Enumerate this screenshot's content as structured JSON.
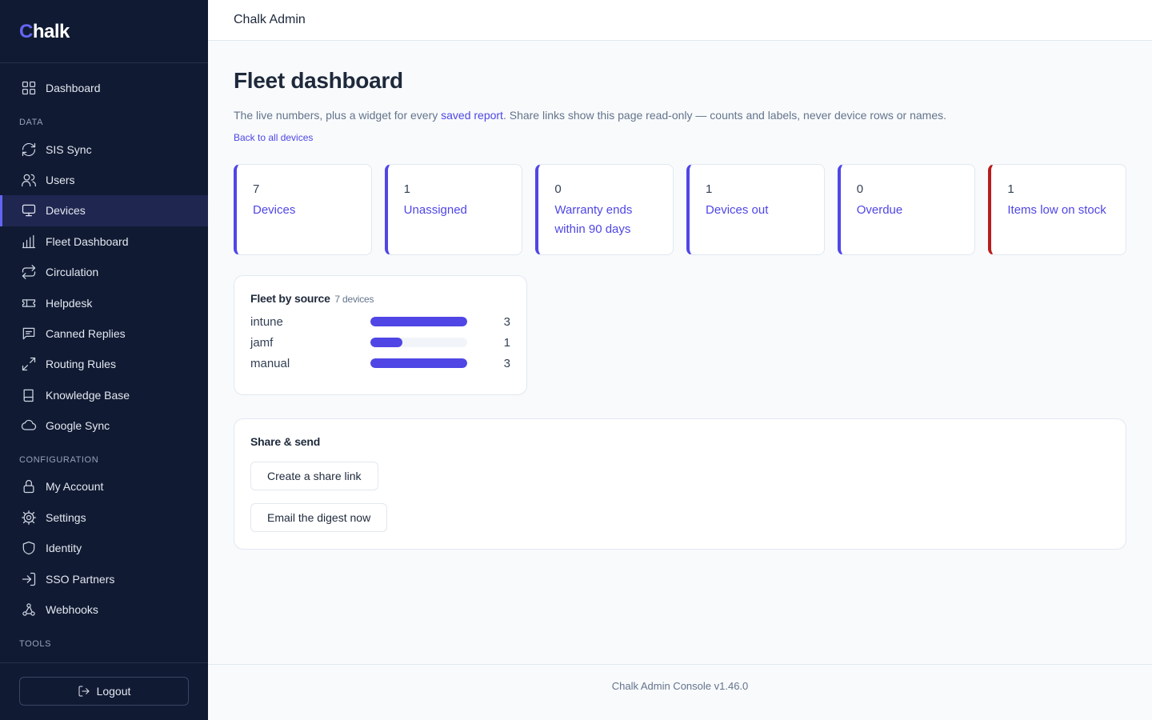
{
  "brand": {
    "first_letter": "C",
    "rest": "halk"
  },
  "sidebar": {
    "items": [
      {
        "label": "Dashboard",
        "icon": "grid-icon"
      },
      {
        "section": "DATA"
      },
      {
        "label": "SIS Sync",
        "icon": "refresh-icon"
      },
      {
        "label": "Users",
        "icon": "users-icon"
      },
      {
        "label": "Devices",
        "icon": "monitor-icon",
        "active": true
      },
      {
        "label": "Fleet Dashboard",
        "icon": "bar-chart-icon"
      },
      {
        "label": "Circulation",
        "icon": "repeat-icon"
      },
      {
        "label": "Helpdesk",
        "icon": "ticket-icon"
      },
      {
        "label": "Canned Replies",
        "icon": "message-icon"
      },
      {
        "label": "Routing Rules",
        "icon": "arrows-icon"
      },
      {
        "label": "Knowledge Base",
        "icon": "book-icon"
      },
      {
        "label": "Google Sync",
        "icon": "cloud-icon"
      },
      {
        "section": "CONFIGURATION"
      },
      {
        "label": "My Account",
        "icon": "lock-icon"
      },
      {
        "label": "Settings",
        "icon": "gear-icon"
      },
      {
        "label": "Identity",
        "icon": "shield-icon"
      },
      {
        "label": "SSO Partners",
        "icon": "login-icon"
      },
      {
        "label": "Webhooks",
        "icon": "webhook-icon"
      },
      {
        "section": "TOOLS"
      }
    ],
    "logout_label": "Logout"
  },
  "topbar": {
    "title": "Chalk Admin"
  },
  "main": {
    "title": "Fleet dashboard",
    "subtitle_before": "The live numbers, plus a widget for every ",
    "subtitle_link": "saved report",
    "subtitle_after": ". Share links show this page read-only — counts and labels, never device rows or names.",
    "back_link": "Back to all devices"
  },
  "stats": [
    {
      "value": "7",
      "label": "Devices",
      "alert": false
    },
    {
      "value": "1",
      "label": "Unassigned",
      "alert": false
    },
    {
      "value": "0",
      "label": "Warranty ends within 90 days",
      "alert": false
    },
    {
      "value": "1",
      "label": "Devices out",
      "alert": false
    },
    {
      "value": "0",
      "label": "Overdue",
      "alert": false
    },
    {
      "value": "1",
      "label": "Items low on stock",
      "alert": true
    }
  ],
  "source_card": {
    "title": "Fleet by source",
    "count_label": "7 devices"
  },
  "chart_data": {
    "type": "bar",
    "categories": [
      "intune",
      "jamf",
      "manual"
    ],
    "values": [
      3,
      1,
      3
    ],
    "max": 3
  },
  "share_card": {
    "title": "Share & send",
    "create_link_label": "Create a share link",
    "email_digest_label": "Email the digest now"
  },
  "footer": {
    "version": "Chalk Admin Console v1.46.0"
  },
  "colors": {
    "accent": "#4f46e5",
    "alert": "#b91c1c",
    "sidebar_bg": "#111a33"
  }
}
